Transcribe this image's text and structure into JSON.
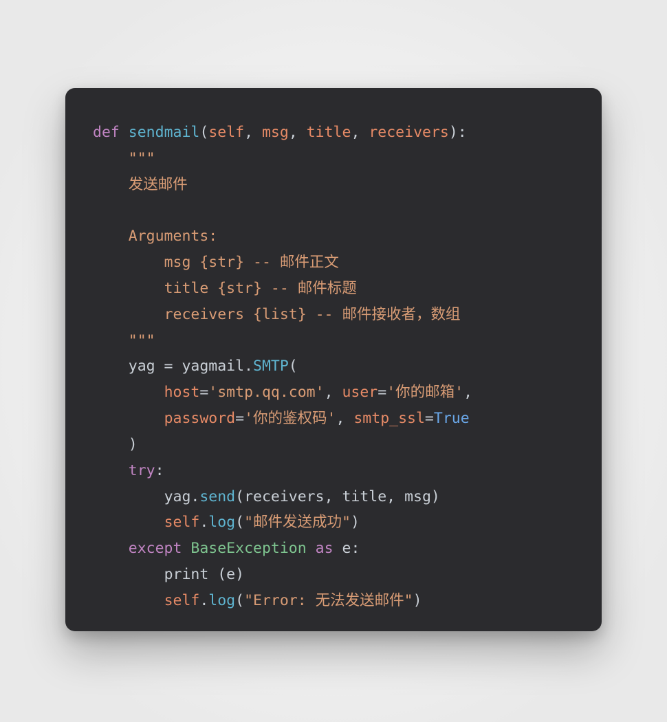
{
  "code": {
    "l1": {
      "def": "def",
      "sp1": " ",
      "fn": "sendmail",
      "op": "(",
      "p1": "self",
      "c1": ", ",
      "p2": "msg",
      "c2": ", ",
      "p3": "title",
      "c3": ", ",
      "p4": "receivers",
      "close": "):"
    },
    "l2": {
      "indent": "    ",
      "q": "\"\"\""
    },
    "l3": {
      "indent": "    ",
      "txt": "发送邮件"
    },
    "l4": {
      "indent": ""
    },
    "l5": {
      "indent": "    ",
      "txt": "Arguments:"
    },
    "l6": {
      "indent": "        ",
      "txt": "msg {str} -- 邮件正文"
    },
    "l7": {
      "indent": "        ",
      "txt": "title {str} -- 邮件标题"
    },
    "l8": {
      "indent": "        ",
      "txt": "receivers {list} -- 邮件接收者，数组"
    },
    "l9": {
      "indent": "    ",
      "q": "\"\"\""
    },
    "l10": {
      "indent": "    ",
      "a": "yag = yagmail.",
      "b": "SMTP",
      "c": "("
    },
    "l11": {
      "indent": "        ",
      "k1": "host",
      "e1": "=",
      "v1": "'smtp.qq.com'",
      "c1": ", ",
      "k2": "user",
      "e2": "=",
      "v2": "'你的邮箱'",
      "tail": ","
    },
    "l12": {
      "indent": "        ",
      "k1": "password",
      "e1": "=",
      "v1": "'你的鉴权码'",
      "c1": ", ",
      "k2": "smtp_ssl",
      "e2": "=",
      "v2": "True"
    },
    "l13": {
      "indent": "    ",
      "txt": ")"
    },
    "l14": {
      "indent": "    ",
      "kw": "try",
      "colon": ":"
    },
    "l15": {
      "indent": "        ",
      "a": "yag.",
      "b": "send",
      "c": "(receivers, title, msg)"
    },
    "l16": {
      "indent": "        ",
      "p": "self",
      "dot": ".",
      "m": "log",
      "op": "(",
      "s": "\"邮件发送成功\"",
      "cl": ")"
    },
    "l17": {
      "indent": "    ",
      "kw1": "except",
      "sp": " ",
      "cls": "BaseException",
      "sp2": " ",
      "kw2": "as",
      "sp3": " ",
      "var": "e",
      "colon": ":"
    },
    "l18": {
      "indent": "        ",
      "txt": "print (e)"
    },
    "l19": {
      "indent": "        ",
      "p": "self",
      "dot": ".",
      "m": "log",
      "op": "(",
      "s": "\"Error: 无法发送邮件\"",
      "cl": ")"
    }
  }
}
